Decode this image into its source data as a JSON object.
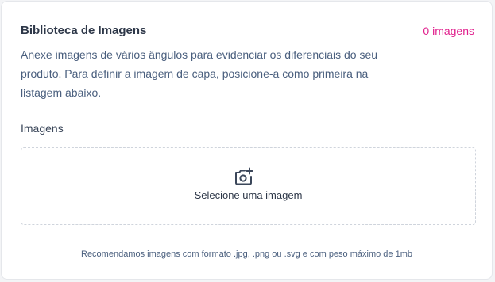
{
  "library": {
    "title": "Biblioteca de Imagens",
    "count_label": "0 imagens",
    "description": "Anexe imagens de vários ângulos para evidenciar os diferenciais do seu produto. Para definir a imagem de capa, posicione-a como primeira na listagem abaixo."
  },
  "images_field": {
    "label": "Imagens",
    "dropzone_label": "Selecione uma imagem",
    "icon": "camera-plus-icon"
  },
  "footer": {
    "note": "Recomendamos imagens com formato .jpg, .png ou .svg e com peso máximo de 1mb"
  },
  "colors": {
    "accent": "#e01e8c",
    "text": "#2d3748",
    "muted": "#4a5f7e"
  }
}
